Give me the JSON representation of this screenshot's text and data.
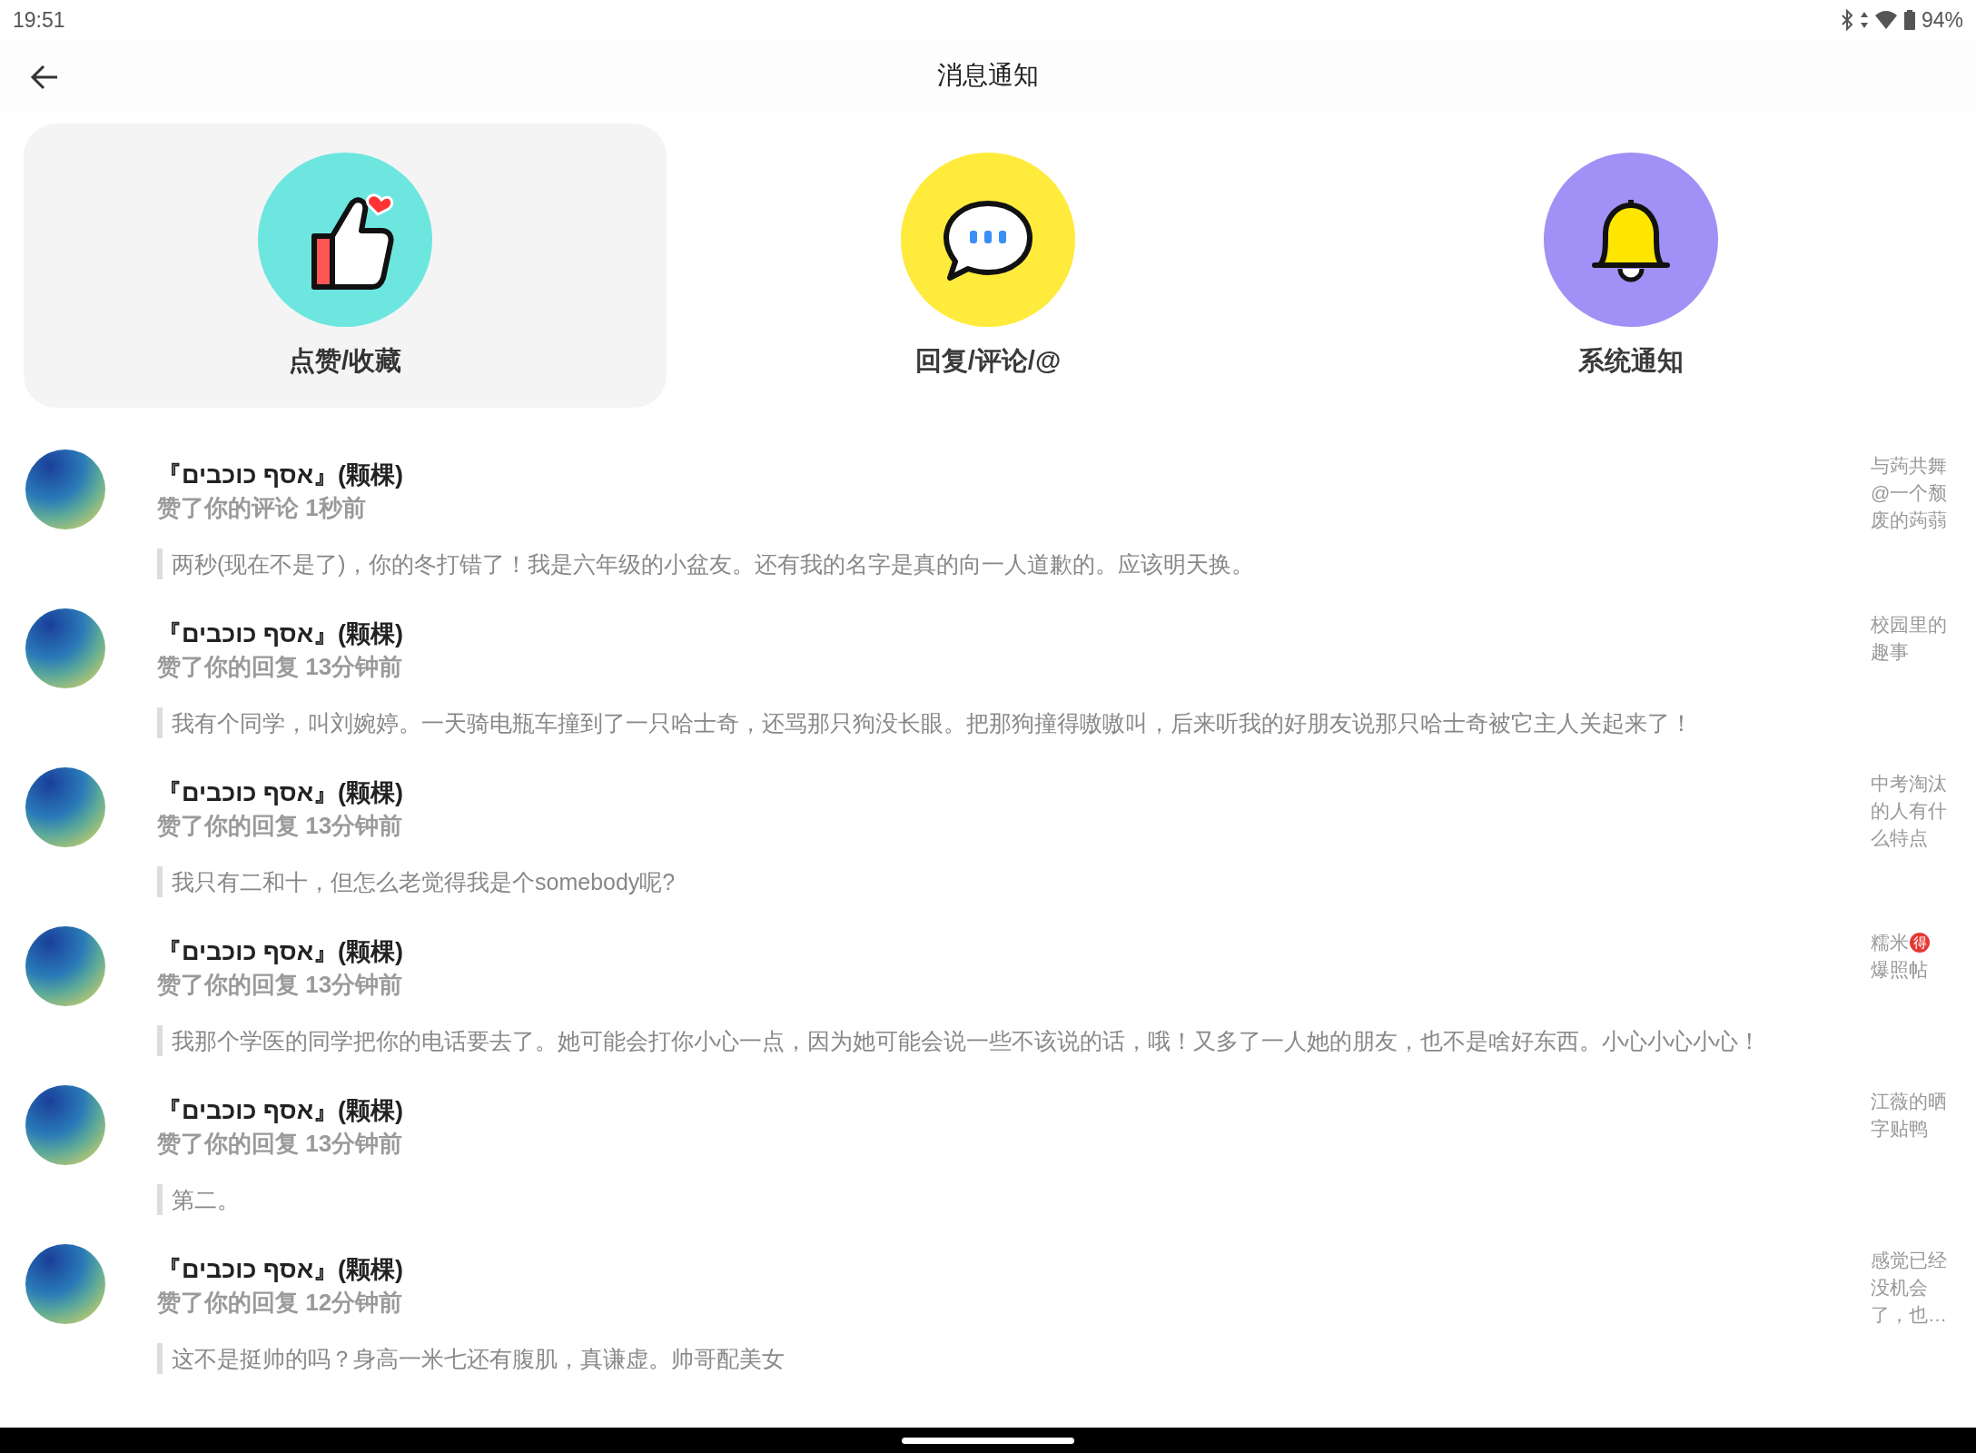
{
  "status_bar": {
    "time": "19:51",
    "battery": "94%"
  },
  "header": {
    "title": "消息通知"
  },
  "categories": [
    {
      "kind": "like",
      "label": "点赞/收藏",
      "selected": true
    },
    {
      "kind": "reply",
      "label": "回复/评论/@",
      "selected": false
    },
    {
      "kind": "system",
      "label": "系统通知",
      "selected": false
    }
  ],
  "notifications": [
    {
      "user": "『אסף כוכבים』(颗棵)",
      "action": "赞了你的评论 1秒前",
      "quote": "两秒(现在不是了)，你的冬打错了！我是六年级的小盆友。还有我的名字是真的向一人道歉的。应该明天换。",
      "topic": [
        {
          "kind": "text",
          "text": "与蒟共舞@一个颓废的蒟蒻"
        }
      ]
    },
    {
      "user": "『אסף כוכבים』(颗棵)",
      "action": "赞了你的回复 13分钟前",
      "quote": "我有个同学，叫刘婉婷。一天骑电瓶车撞到了一只哈士奇，还骂那只狗没长眼。把那狗撞得嗷嗷叫，后来听我的好朋友说那只哈士奇被它主人关起来了！",
      "topic": [
        {
          "kind": "text",
          "text": "校园里的趣事"
        }
      ]
    },
    {
      "user": "『אסף כוכבים』(颗棵)",
      "action": "赞了你的回复 13分钟前",
      "quote": "我只有二和十，但怎么老觉得我是个somebody呢?",
      "topic": [
        {
          "kind": "text",
          "text": "中考淘汰的人有什么特点"
        }
      ]
    },
    {
      "user": "『אסף כוכבים』(颗棵)",
      "action": "赞了你的回复 13分钟前",
      "quote": "我那个学医的同学把你的电话要去了。她可能会打你小心一点，因为她可能会说一些不该说的话，哦！又多了一人她的朋友，也不是啥好东西。小心小心小心！",
      "topic": [
        {
          "kind": "text",
          "text": "糯米"
        },
        {
          "kind": "badge",
          "text": "得"
        },
        {
          "kind": "text",
          "text": "爆照帖"
        }
      ]
    },
    {
      "user": "『אסף כוכבים』(颗棵)",
      "action": "赞了你的回复 13分钟前",
      "quote": "第二。",
      "topic": [
        {
          "kind": "text",
          "text": "江薇的晒字贴鸭"
        }
      ]
    },
    {
      "user": "『אסף כוכבים』(颗棵)",
      "action": "赞了你的回复 12分钟前",
      "quote": "这不是挺帅的吗？身高一米七还有腹肌，真谦虚。帅哥配美女",
      "topic": [
        {
          "kind": "text",
          "text": "感觉已经没机会了，也…"
        }
      ]
    }
  ]
}
